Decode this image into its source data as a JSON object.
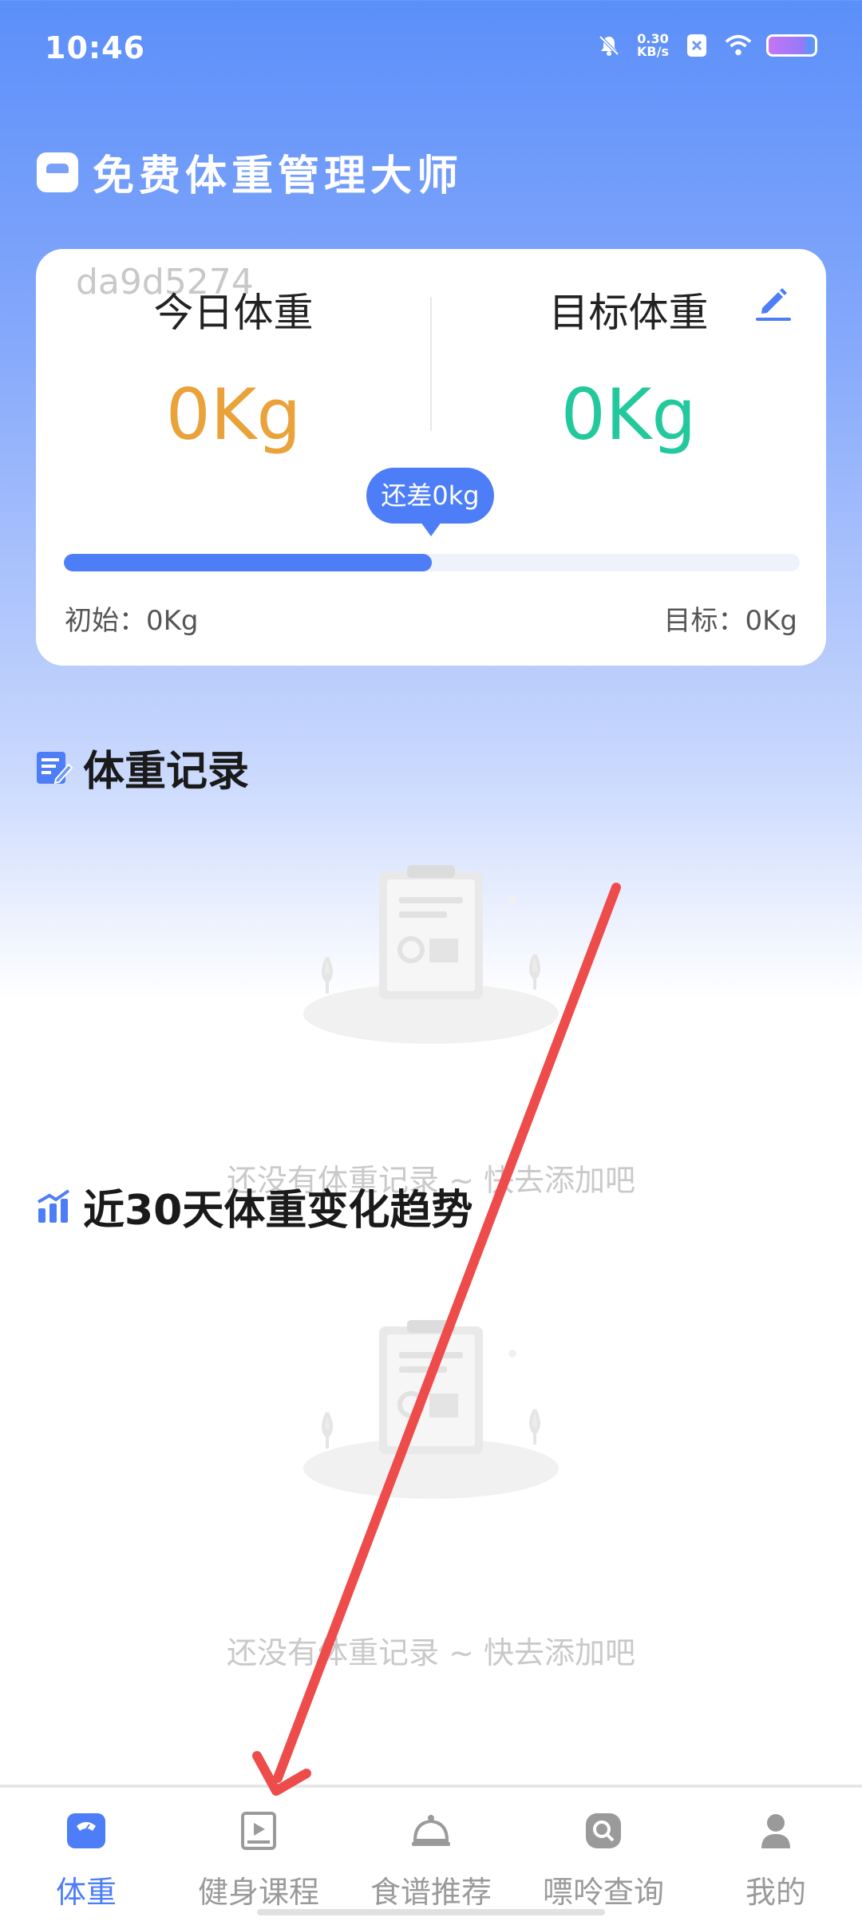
{
  "status_bar": {
    "time": "10:46",
    "net_speed_value": "0.30",
    "net_speed_unit": "KB/s",
    "icons": [
      "mute-icon",
      "net-speed",
      "sim-x-icon",
      "wifi-icon",
      "battery-icon"
    ]
  },
  "app": {
    "title": "免费体重管理大师",
    "logo_icon": "scale-logo-icon"
  },
  "weight_card": {
    "watermark": "da9d5274",
    "today_label": "今日体重",
    "today_value": "0Kg",
    "target_label": "目标体重",
    "target_value": "0Kg",
    "edit_icon": "pencil-icon",
    "diff_text": "还差0kg",
    "progress_fraction": 0.5,
    "start_text": "初始：0Kg",
    "goal_text": "目标：0Kg",
    "colors": {
      "today": "#eaa23a",
      "target": "#23c99d",
      "accent": "#4d7ef7"
    }
  },
  "records_section": {
    "heading": "体重记录",
    "icon": "record-edit-icon",
    "empty_text": "还没有体重记录 ~ 快去添加吧"
  },
  "trend_section": {
    "heading": "近30天体重变化趋势",
    "icon": "bar-trend-icon",
    "empty_text": "还没有体重记录 ~ 快去添加吧"
  },
  "bottom_nav": {
    "items": [
      {
        "label": "体重",
        "icon": "scale-icon",
        "active": true
      },
      {
        "label": "健身课程",
        "icon": "video-course-icon",
        "active": false
      },
      {
        "label": "食谱推荐",
        "icon": "food-cloche-icon",
        "active": false
      },
      {
        "label": "嘌呤查询",
        "icon": "search-magnifier-icon",
        "active": false
      },
      {
        "label": "我的",
        "icon": "user-icon",
        "active": false
      }
    ]
  },
  "annotation": {
    "color": "#ee4b4b"
  }
}
